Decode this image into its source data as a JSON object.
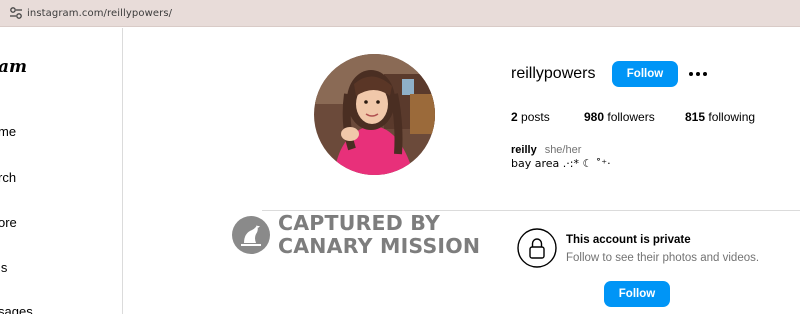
{
  "browser": {
    "url": "instagram.com/reillypowers/",
    "site_icon": "tune-settings-icon"
  },
  "sidebar": {
    "logo_text": "am",
    "items": [
      {
        "label": "me",
        "icon": "home-icon"
      },
      {
        "label": "rch",
        "icon": "search-icon"
      },
      {
        "label": "ore",
        "icon": "explore-icon"
      },
      {
        "label": "ls",
        "icon": "reels-icon"
      },
      {
        "label": "sages",
        "icon": "messages-icon"
      }
    ]
  },
  "profile": {
    "username": "reillypowers",
    "follow_label": "Follow",
    "more_icon": "more-horizontal-icon",
    "stats": {
      "posts_count": "2",
      "posts_label": " posts",
      "followers_count": "980",
      "followers_label": " followers",
      "following_count": "815",
      "following_label": " following"
    },
    "fullname": "reilly",
    "pronouns": "she/her",
    "bio": "bay area .·:* ☾ ˚⁺‧"
  },
  "watermark": {
    "line1": "CAPTURED BY",
    "line2": "CANARY MISSION",
    "icon": "canary-bird-icon"
  },
  "private_notice": {
    "title": "This account is private",
    "subtitle": "Follow to see their photos and videos.",
    "button_label": "Follow",
    "icon": "lock-icon"
  },
  "colors": {
    "accent": "#0095f6",
    "address_bar": "#e8dcd9",
    "watermark": "#7d7d7d",
    "muted_text": "#737373"
  }
}
